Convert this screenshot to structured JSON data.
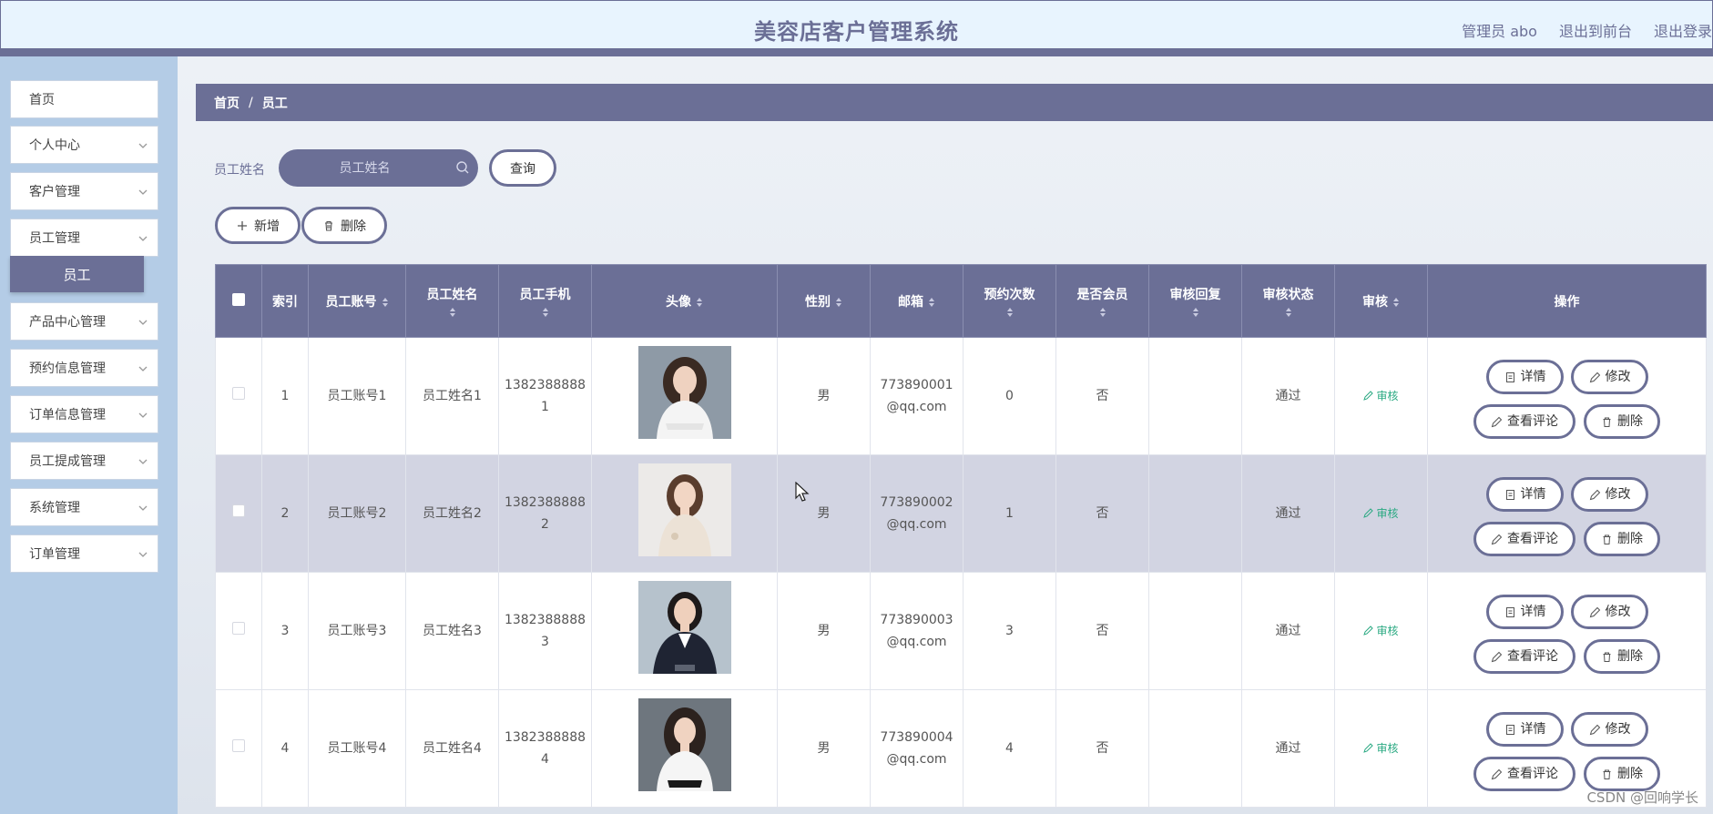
{
  "header": {
    "title": "美容店客户管理系统",
    "admin_label": "管理员 abo",
    "exit_front": "退出到前台",
    "logout": "退出登录"
  },
  "sidebar": {
    "items": [
      {
        "label": "首页"
      },
      {
        "label": "个人中心"
      },
      {
        "label": "客户管理"
      },
      {
        "label": "员工管理"
      },
      {
        "label": "产品中心管理"
      },
      {
        "label": "预约信息管理"
      },
      {
        "label": "订单信息管理"
      },
      {
        "label": "员工提成管理"
      },
      {
        "label": "系统管理"
      },
      {
        "label": "订单管理"
      }
    ],
    "submenu_active": "员工"
  },
  "breadcrumb": {
    "home": "首页",
    "separator": "/",
    "current": "员工"
  },
  "search": {
    "label": "员工姓名",
    "placeholder": "员工姓名",
    "query_button": "查询"
  },
  "actions": {
    "add": "新增",
    "delete": "删除"
  },
  "table": {
    "headers": {
      "index": "索引",
      "account": "员工账号",
      "name": "员工姓名",
      "phone": "员工手机",
      "avatar": "头像",
      "gender": "性别",
      "email": "邮箱",
      "appointments": "预约次数",
      "member": "是否会员",
      "review_reply": "审核回复",
      "review_status": "审核状态",
      "review": "审核",
      "operations": "操作"
    },
    "rows": [
      {
        "index": "1",
        "account": "员工账号1",
        "name": "员工姓名1",
        "phone": "13823888881",
        "gender": "男",
        "email": "773890001@qq.com",
        "appointments": "0",
        "member": "否",
        "review_reply": "",
        "review_status": "通过",
        "review": "审核"
      },
      {
        "index": "2",
        "account": "员工账号2",
        "name": "员工姓名2",
        "phone": "13823888882",
        "gender": "男",
        "email": "773890002@qq.com",
        "appointments": "1",
        "member": "否",
        "review_reply": "",
        "review_status": "通过",
        "review": "审核"
      },
      {
        "index": "3",
        "account": "员工账号3",
        "name": "员工姓名3",
        "phone": "13823888883",
        "gender": "男",
        "email": "773890003@qq.com",
        "appointments": "3",
        "member": "否",
        "review_reply": "",
        "review_status": "通过",
        "review": "审核"
      },
      {
        "index": "4",
        "account": "员工账号4",
        "name": "员工姓名4",
        "phone": "13823888884",
        "gender": "男",
        "email": "773890004@qq.com",
        "appointments": "4",
        "member": "否",
        "review_reply": "",
        "review_status": "通过",
        "review": "审核"
      }
    ],
    "row_ops": {
      "detail": "详情",
      "edit": "修改",
      "comments": "查看评论",
      "delete": "删除"
    }
  },
  "watermark": "CSDN @回响学长",
  "colors": {
    "primary": "#6b6f96",
    "sidebar_bg": "#b4cce6",
    "header_bg": "#e8f4fe",
    "audit_green": "#2aa982"
  }
}
